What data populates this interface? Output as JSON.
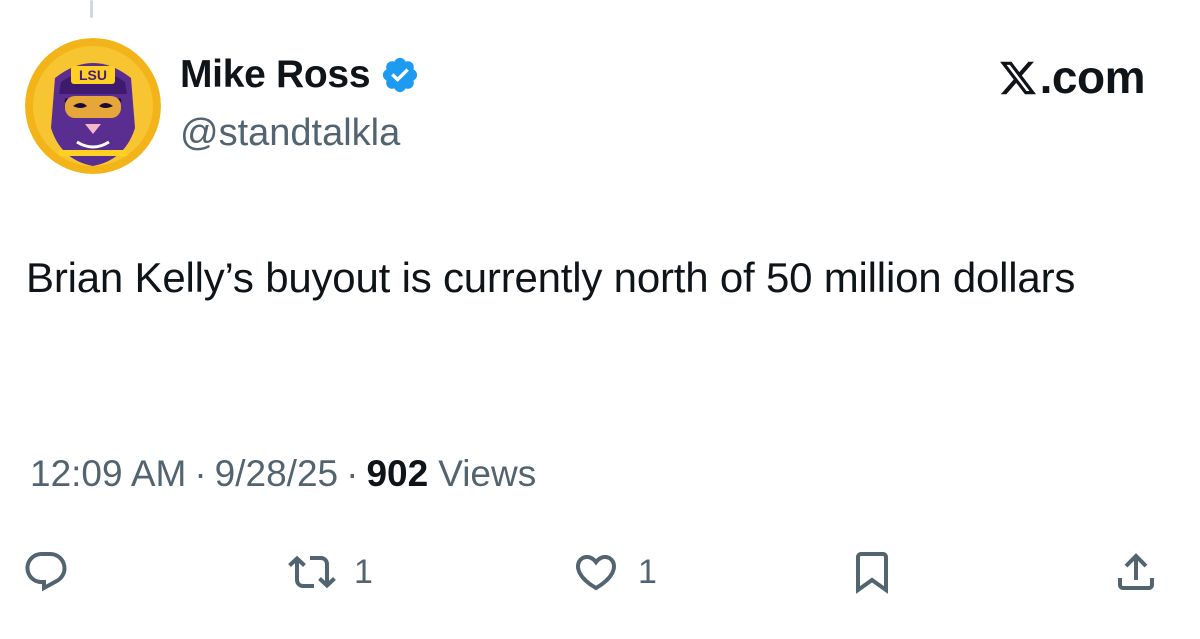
{
  "user": {
    "display_name": "Mike Ross",
    "handle": "@standtalkla",
    "verified": true,
    "avatar": {
      "description_icon": "lsu-tiger-avatar",
      "badge_text": "LSU"
    }
  },
  "site": {
    "label": ".com",
    "logo_icon": "x-logo-icon"
  },
  "tweet": {
    "text": "Brian Kelly’s buyout is currently north of 50 million dollars",
    "time": "12:09 AM",
    "separator": "·",
    "date": "9/28/25",
    "views_count": "902",
    "views_label": "Views"
  },
  "actions": {
    "reply": {
      "icon": "reply-icon",
      "count": ""
    },
    "retweet": {
      "icon": "retweet-icon",
      "count": "1"
    },
    "like": {
      "icon": "heart-icon",
      "count": "1"
    },
    "bookmark": {
      "icon": "bookmark-icon",
      "count": ""
    },
    "share": {
      "icon": "share-icon",
      "count": ""
    }
  },
  "colors": {
    "text_primary": "#0f1419",
    "text_secondary": "#536471",
    "verified_blue": "#1d9bf0",
    "lsu_purple": "#461d7c",
    "lsu_gold": "#fdd023"
  }
}
